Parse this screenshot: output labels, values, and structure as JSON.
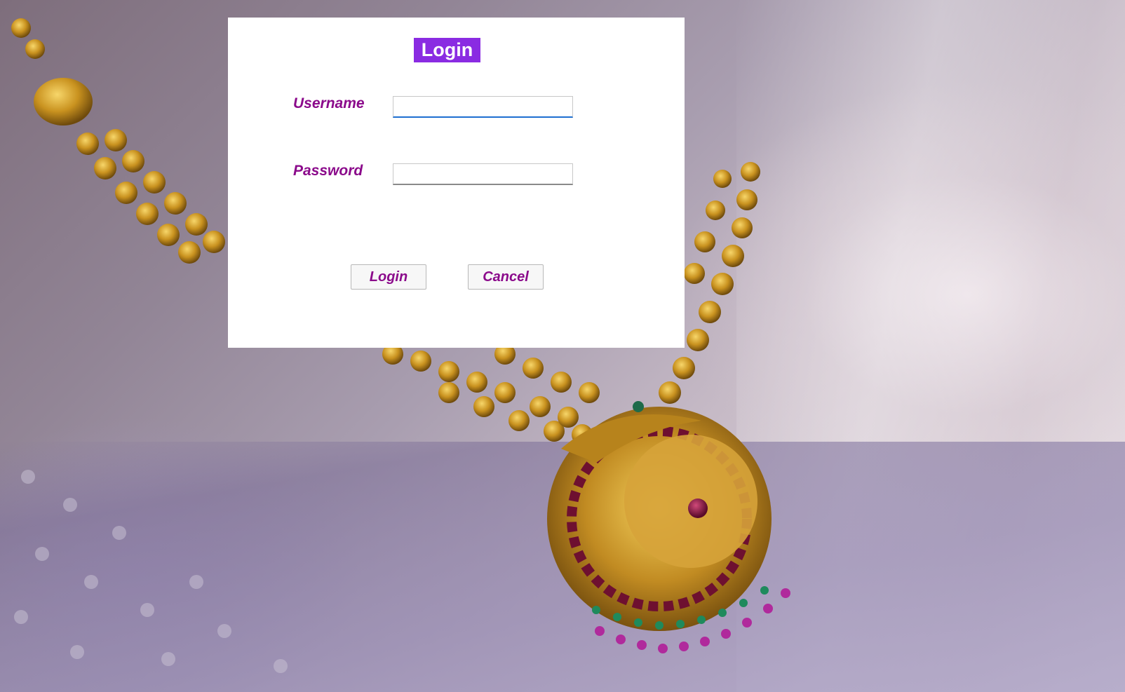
{
  "dialog": {
    "title": "Login",
    "username_label": "Username",
    "password_label": "Password",
    "username_value": "",
    "password_value": "",
    "login_button": "Login",
    "cancel_button": "Cancel"
  },
  "colors": {
    "title_background": "#8a2be2",
    "label_text": "#8b0a8b",
    "focused_input_border": "#1e6fd0",
    "dialog_background": "#ffffff"
  },
  "background_image": {
    "subject": "gold temple necklace with pendant on lavender saree"
  }
}
